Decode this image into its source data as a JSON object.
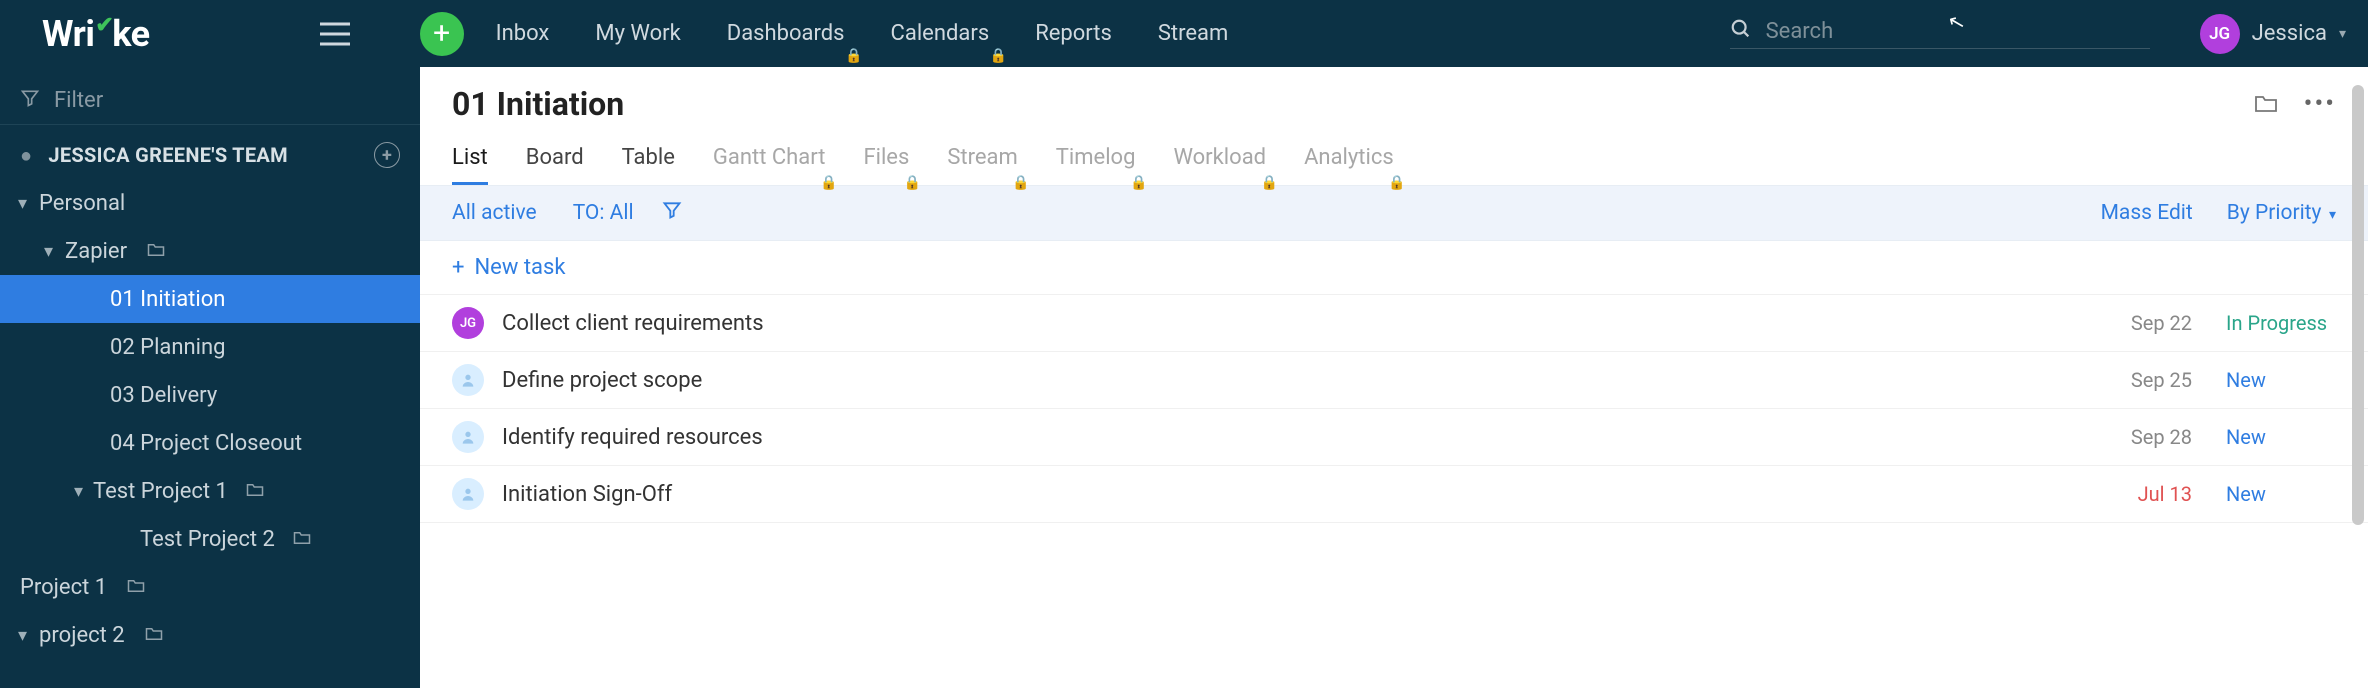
{
  "app": {
    "logo_text": "Wrike"
  },
  "topnav": {
    "items": [
      {
        "label": "Inbox",
        "locked": false
      },
      {
        "label": "My Work",
        "locked": false
      },
      {
        "label": "Dashboards",
        "locked": true
      },
      {
        "label": "Calendars",
        "locked": true
      },
      {
        "label": "Reports",
        "locked": false
      },
      {
        "label": "Stream",
        "locked": false
      }
    ]
  },
  "search": {
    "placeholder": "Search"
  },
  "user": {
    "initials": "JG",
    "name": "Jessica"
  },
  "sidebar": {
    "filter_placeholder": "Filter",
    "team_label": "JESSICA GREENE'S TEAM",
    "tree": [
      {
        "label": "Personal",
        "depth": 0,
        "chevron": "down",
        "folder": false
      },
      {
        "label": "Zapier",
        "depth": 1,
        "chevron": "down",
        "folder": true
      },
      {
        "label": "01 Initiation",
        "depth": 2,
        "selected": true
      },
      {
        "label": "02 Planning",
        "depth": 2
      },
      {
        "label": "03 Delivery",
        "depth": 2
      },
      {
        "label": "04 Project Closeout",
        "depth": 2
      },
      {
        "label": "Test Project 1",
        "depth": "2b",
        "chevron": "down",
        "folder": true
      },
      {
        "label": "Test Project 2",
        "depth": 3,
        "folder": true
      },
      {
        "label": "Project 1",
        "depth": 0,
        "folder": true
      },
      {
        "label": "project 2",
        "depth": 0,
        "chevron": "down",
        "folder": true
      }
    ]
  },
  "page": {
    "title": "01 Initiation",
    "view_tabs": [
      {
        "label": "List",
        "active": true
      },
      {
        "label": "Board"
      },
      {
        "label": "Table"
      },
      {
        "label": "Gantt Chart",
        "locked": true
      },
      {
        "label": "Files",
        "locked": true
      },
      {
        "label": "Stream",
        "locked": true
      },
      {
        "label": "Timelog",
        "locked": true
      },
      {
        "label": "Workload",
        "locked": true
      },
      {
        "label": "Analytics",
        "locked": true
      }
    ],
    "filters": {
      "active": "All active",
      "to": "TO: All",
      "mass_edit": "Mass Edit",
      "by_priority": "By Priority"
    },
    "new_task_label": "New task",
    "tasks": [
      {
        "assignee": "JG",
        "assignee_type": "jg",
        "title": "Collect client requirements",
        "date": "Sep 22",
        "overdue": false,
        "status": "In Progress",
        "status_type": "progress"
      },
      {
        "assignee": "",
        "assignee_type": "un",
        "title": "Define project scope",
        "date": "Sep 25",
        "overdue": false,
        "status": "New",
        "status_type": "new"
      },
      {
        "assignee": "",
        "assignee_type": "un",
        "title": "Identify required resources",
        "date": "Sep 28",
        "overdue": false,
        "status": "New",
        "status_type": "new"
      },
      {
        "assignee": "",
        "assignee_type": "un",
        "title": "Initiation Sign-Off",
        "date": "Jul 13",
        "overdue": true,
        "status": "New",
        "status_type": "new"
      }
    ]
  }
}
